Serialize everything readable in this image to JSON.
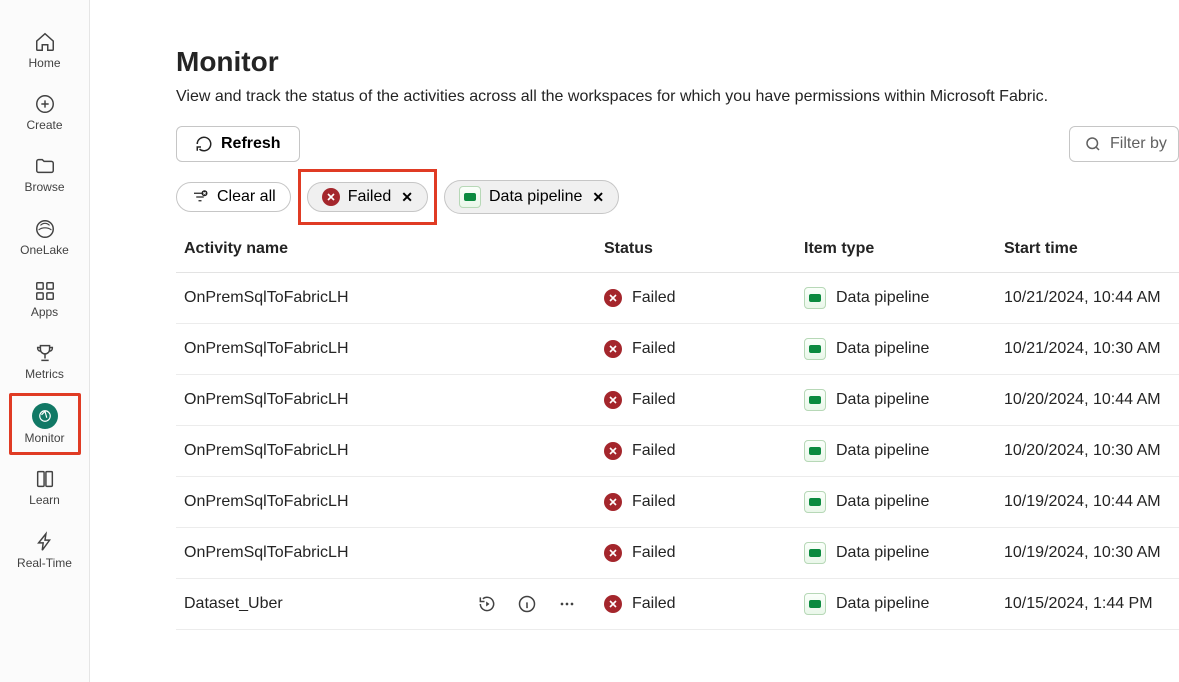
{
  "nav": {
    "items": [
      {
        "label": "Home",
        "id": "home"
      },
      {
        "label": "Create",
        "id": "create"
      },
      {
        "label": "Browse",
        "id": "browse"
      },
      {
        "label": "OneLake",
        "id": "onelake"
      },
      {
        "label": "Apps",
        "id": "apps"
      },
      {
        "label": "Metrics",
        "id": "metrics"
      },
      {
        "label": "Monitor",
        "id": "monitor",
        "active": true,
        "highlighted": true
      },
      {
        "label": "Learn",
        "id": "learn"
      },
      {
        "label": "Real-Time",
        "id": "realtime"
      }
    ]
  },
  "page": {
    "title": "Monitor",
    "subtitle": "View and track the status of the activities across all the workspaces for which you have permissions within Microsoft Fabric."
  },
  "toolbar": {
    "refresh_label": "Refresh",
    "filter_placeholder": "Filter by"
  },
  "filters": {
    "clear_all_label": "Clear all",
    "chips": [
      {
        "label": "Failed",
        "type": "status",
        "highlighted": true
      },
      {
        "label": "Data pipeline",
        "type": "itemtype"
      }
    ]
  },
  "table": {
    "headers": {
      "activity": "Activity name",
      "status": "Status",
      "itemtype": "Item type",
      "start": "Start time"
    },
    "rows": [
      {
        "activity": "OnPremSqlToFabricLH",
        "status": "Failed",
        "itemtype": "Data pipeline",
        "start": "10/21/2024, 10:44 AM"
      },
      {
        "activity": "OnPremSqlToFabricLH",
        "status": "Failed",
        "itemtype": "Data pipeline",
        "start": "10/21/2024, 10:30 AM"
      },
      {
        "activity": "OnPremSqlToFabricLH",
        "status": "Failed",
        "itemtype": "Data pipeline",
        "start": "10/20/2024, 10:44 AM"
      },
      {
        "activity": "OnPremSqlToFabricLH",
        "status": "Failed",
        "itemtype": "Data pipeline",
        "start": "10/20/2024, 10:30 AM"
      },
      {
        "activity": "OnPremSqlToFabricLH",
        "status": "Failed",
        "itemtype": "Data pipeline",
        "start": "10/19/2024, 10:44 AM"
      },
      {
        "activity": "OnPremSqlToFabricLH",
        "status": "Failed",
        "itemtype": "Data pipeline",
        "start": "10/19/2024, 10:30 AM"
      },
      {
        "activity": "Dataset_Uber",
        "status": "Failed",
        "itemtype": "Data pipeline",
        "start": "10/15/2024, 1:44 PM",
        "show_actions": true
      }
    ]
  }
}
